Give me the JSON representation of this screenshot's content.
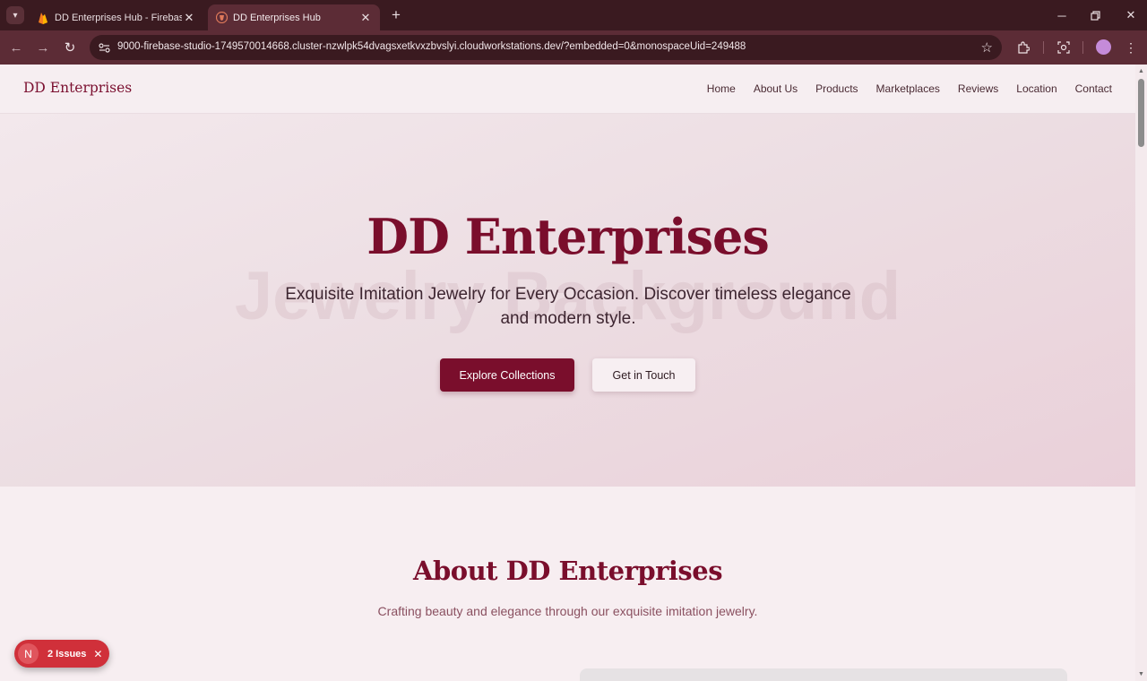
{
  "browser": {
    "tabs": [
      {
        "title": "DD Enterprises Hub - Firebase Studio",
        "icon": "firebase-icon",
        "active": false
      },
      {
        "title": "DD Enterprises Hub",
        "icon": "site-shield-icon",
        "active": true
      }
    ],
    "url": "9000-firebase-studio-1749570014668.cluster-nzwlpk54dvagsxetkvxzbvslyi.cloudworkstations.dev/?embedded=0&monospaceUid=249488",
    "window_controls": [
      "minimize",
      "maximize",
      "close"
    ]
  },
  "site": {
    "brand": "DD Enterprises",
    "nav": [
      "Home",
      "About Us",
      "Products",
      "Marketplaces",
      "Reviews",
      "Location",
      "Contact"
    ],
    "hero": {
      "background_text": "Jewelry Background",
      "title": "DD Enterprises",
      "subtitle": "Exquisite Imitation Jewelry for Every Occasion. Discover timeless elegance and modern style.",
      "primary_button": "Explore Collections",
      "secondary_button": "Get in Touch"
    },
    "about": {
      "title": "About DD Enterprises",
      "subtitle": "Crafting beauty and elegance through our exquisite imitation jewelry."
    }
  },
  "dev_overlay": {
    "logo": "N",
    "issues_label": "2 Issues"
  },
  "colors": {
    "brand": "#7a0e2c",
    "chrome_dark": "#3a1a20",
    "chrome_toolbar": "#5c2c36",
    "issues_badge": "#d0303a"
  }
}
